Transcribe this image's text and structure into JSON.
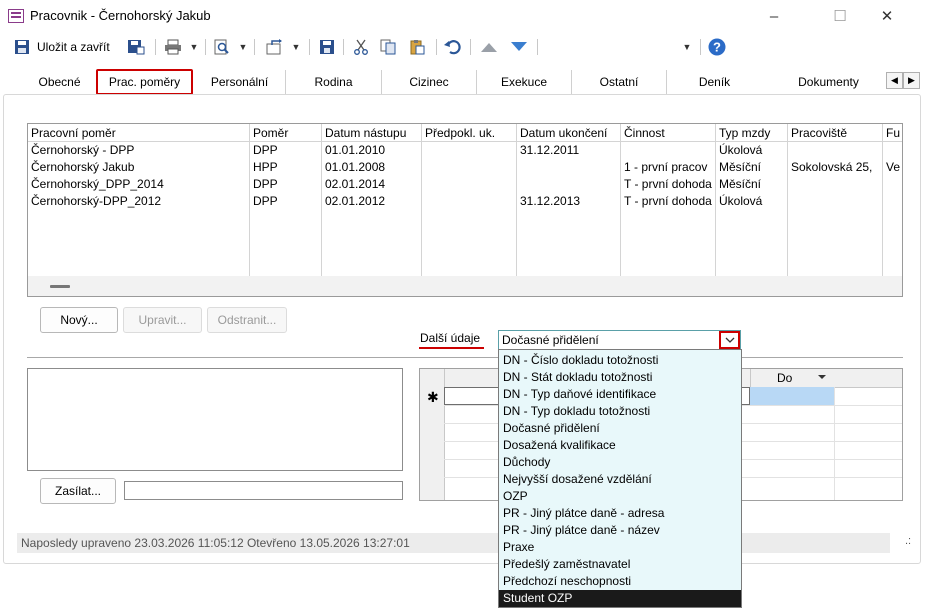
{
  "window": {
    "title": "Pracovnik - Černohorský Jakub",
    "minimize": "–",
    "maximize": "☐",
    "close": "✕"
  },
  "toolbar": {
    "save_close_label": "Uložit a zavřít"
  },
  "tabs": [
    "Obecné",
    "Prac. poměry",
    "Personální",
    "Rodina",
    "Cizinec",
    "Exekuce",
    "Ostatní",
    "Deník",
    "Dokumenty"
  ],
  "tab_scroll": {
    "left": "◀",
    "right": "▶"
  },
  "grid": {
    "columns": [
      "Pracovní poměr",
      "Poměr",
      "Datum nástupu",
      "Předpokl. uk.",
      "Datum ukončení",
      "Činnost",
      "Typ mzdy",
      "Pracoviště",
      "Fu"
    ],
    "rows": [
      [
        "Černohorský - DPP",
        "DPP",
        "01.01.2010",
        "",
        "31.12.2011",
        "",
        "Úkolová",
        "",
        ""
      ],
      [
        "Černohorský Jakub",
        "HPP",
        "01.01.2008",
        "",
        "",
        "1 - první pracov",
        "Měsíční",
        "Sokolovská 25,",
        "Ve"
      ],
      [
        "Černohorský_DPP_2014",
        "DPP",
        "02.01.2014",
        "",
        "",
        "T - první dohoda",
        "Měsíční",
        "",
        ""
      ],
      [
        "Černohorský-DPP_2012",
        "DPP",
        "02.01.2012",
        "",
        "31.12.2013",
        "T - první dohoda",
        "Úkolová",
        "",
        ""
      ]
    ]
  },
  "buttons": {
    "new": "Nový...",
    "edit": "Upravit...",
    "delete": "Odstranit...",
    "send": "Zasílat..."
  },
  "dalsi_udaje": {
    "label": "Další údaje",
    "selected": "Dočasné přidělení",
    "options": [
      "DN - Číslo dokladu totožnosti",
      "DN - Stát dokladu totožnosti",
      "DN - Typ daňové identifikace",
      "DN - Typ dokladu totožnosti",
      "Dočasné přidělení",
      "Dosažená kvalifikace",
      "Důchody",
      "Nejvyšší dosažené vzdělání",
      "OZP",
      "PR - Jiný plátce daně - adresa",
      "PR - Jiný plátce daně - název",
      "Praxe",
      "Předešlý zaměstnavatel",
      "Předchozí neschopnosti",
      "Student OZP"
    ],
    "highlighted": "Student OZP"
  },
  "subgrid": {
    "do_header": "Do",
    "new_row_marker": "✱"
  },
  "status": {
    "text": "Naposledy upraveno 23.03.2026 11:05:12 Otevřeno 13.05.2026 13:27:01",
    "grip": ".:"
  },
  "icons": [
    "save-icon",
    "save-as-icon",
    "print-icon",
    "preview-icon",
    "export-icon",
    "save-all-icon",
    "cut-icon",
    "copy-icon",
    "paste-icon",
    "undo-icon",
    "up-icon",
    "down-icon",
    "help-icon"
  ],
  "colors": {
    "accent_red": "#cc0000",
    "combo_border": "#5aa0a8",
    "dropdown_bg": "#e8f8fa",
    "selection": "#1a1a1a"
  }
}
